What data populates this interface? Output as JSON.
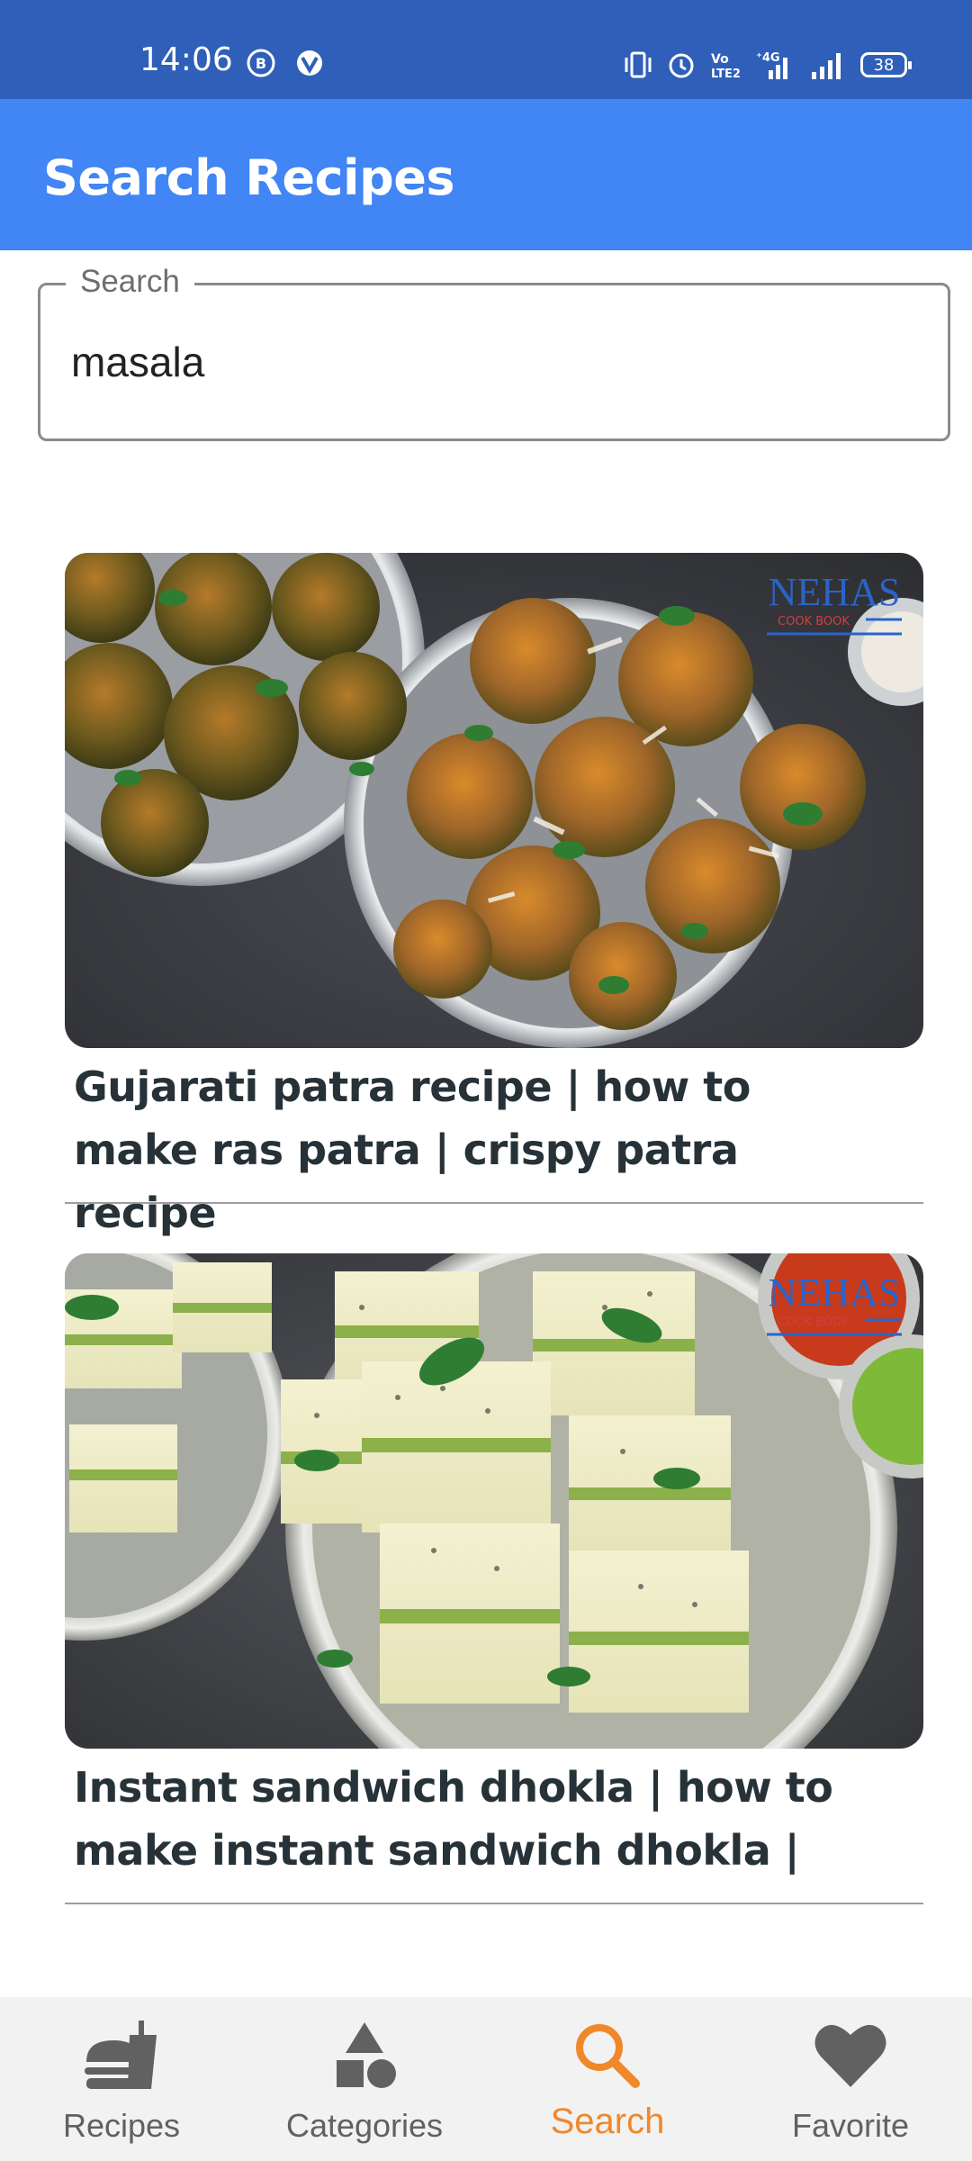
{
  "status_bar": {
    "time": "14:06",
    "battery": "38",
    "icons": [
      "b-circle-icon",
      "vpn-icon",
      "vibrate-icon",
      "alarm-icon",
      "volte-icon",
      "4g-signal-icon",
      "signal-icon",
      "battery-icon"
    ]
  },
  "app_bar": {
    "title": "Search Recipes"
  },
  "search": {
    "label": "Search",
    "value": "masala"
  },
  "results": [
    {
      "title": "Gujarati patra recipe | how to make ras patra | crispy patra recipe",
      "logo": "NEHAS",
      "logo_sub": "COOK BOOK"
    },
    {
      "title": "Instant sandwich dhokla | how to make instant sandwich dhokla |",
      "logo": "NEHAS",
      "logo_sub": "COOK BOOK"
    }
  ],
  "bottom_nav": {
    "items": [
      {
        "label": "Recipes",
        "icon": "fast-food-icon",
        "active": false
      },
      {
        "label": "Categories",
        "icon": "shapes-icon",
        "active": false
      },
      {
        "label": "Search",
        "icon": "search-icon",
        "active": true
      },
      {
        "label": "Favorite",
        "icon": "heart-icon",
        "active": false
      }
    ]
  },
  "colors": {
    "status_bar": "#2f5fb8",
    "app_bar": "#4285f4",
    "active_nav": "#f0882a",
    "inactive_nav": "#616161"
  }
}
